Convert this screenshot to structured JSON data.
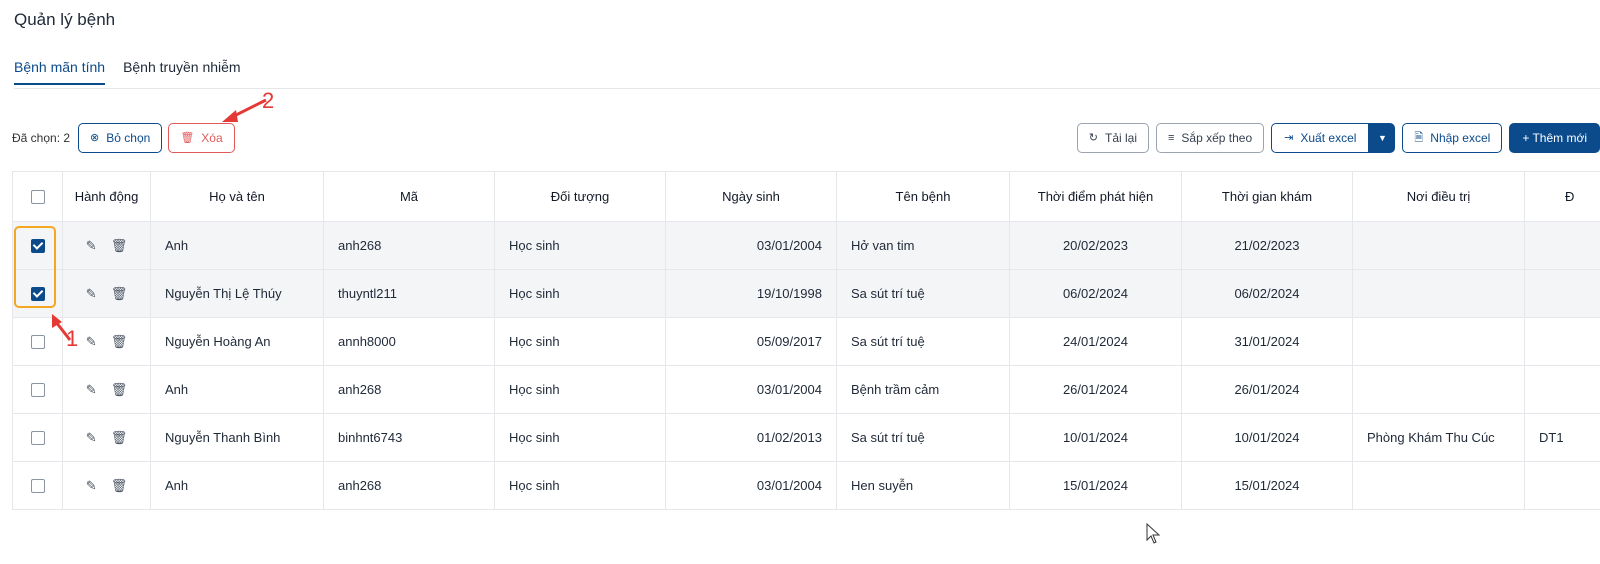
{
  "page_title": "Quản lý bệnh",
  "tabs": [
    {
      "label": "Bệnh mãn tính",
      "active": true
    },
    {
      "label": "Bệnh truyền nhiễm",
      "active": false
    }
  ],
  "toolbar": {
    "selected_text": "Đã chọn: 2",
    "deselect_label": "Bỏ chọn",
    "delete_label": "Xóa",
    "reload_label": "Tải lại",
    "sort_label": "Sắp xếp theo",
    "export_label": "Xuất excel",
    "import_label": "Nhập excel",
    "add_label": "+ Thêm mới"
  },
  "table": {
    "headers": [
      "Hành động",
      "Họ và tên",
      "Mã",
      "Đối tượng",
      "Ngày sinh",
      "Tên bệnh",
      "Thời điểm phát hiện",
      "Thời gian khám",
      "Nơi điều trị",
      "Đ"
    ],
    "rows": [
      {
        "checked": true,
        "name": "Anh",
        "code": "anh268",
        "subject": "Học sinh",
        "dob": "03/01/2004",
        "disease": "Hở van tim",
        "detected": "20/02/2023",
        "exam": "21/02/2023",
        "place": "",
        "extra": ""
      },
      {
        "checked": true,
        "name": "Nguyễn Thị Lệ Thúy",
        "code": "thuyntl211",
        "subject": "Học sinh",
        "dob": "19/10/1998",
        "disease": "Sa sút trí tuệ",
        "detected": "06/02/2024",
        "exam": "06/02/2024",
        "place": "",
        "extra": ""
      },
      {
        "checked": false,
        "name": "Nguyễn Hoàng An",
        "code": "annh8000",
        "subject": "Học sinh",
        "dob": "05/09/2017",
        "disease": "Sa sút trí tuệ",
        "detected": "24/01/2024",
        "exam": "31/01/2024",
        "place": "",
        "extra": ""
      },
      {
        "checked": false,
        "name": "Anh",
        "code": "anh268",
        "subject": "Học sinh",
        "dob": "03/01/2004",
        "disease": "Bệnh trầm cảm",
        "detected": "26/01/2024",
        "exam": "26/01/2024",
        "place": "",
        "extra": ""
      },
      {
        "checked": false,
        "name": "Nguyễn Thanh Bình",
        "code": "binhnt6743",
        "subject": "Học sinh",
        "dob": "01/02/2013",
        "disease": "Sa sút trí tuệ",
        "detected": "10/01/2024",
        "exam": "10/01/2024",
        "place": "Phòng Khám Thu Cúc",
        "extra": "DT1"
      },
      {
        "checked": false,
        "name": "Anh",
        "code": "anh268",
        "subject": "Học sinh",
        "dob": "03/01/2004",
        "disease": "Hen suyễn",
        "detected": "15/01/2024",
        "exam": "15/01/2024",
        "place": "",
        "extra": ""
      }
    ]
  },
  "annotations": {
    "label_1": "1",
    "label_2": "2"
  },
  "icons": {
    "deselect": "close-circle-icon",
    "delete": "trash-icon",
    "reload": "refresh-icon",
    "sort": "sort-lines-icon",
    "export": "export-icon",
    "import": "file-import-icon",
    "edit": "pencil-icon",
    "row_delete": "trash-icon"
  },
  "colors": {
    "primary": "#0b4a8b",
    "danger": "#e05a5a",
    "highlight": "#f5a623",
    "annotation": "#e53935"
  }
}
